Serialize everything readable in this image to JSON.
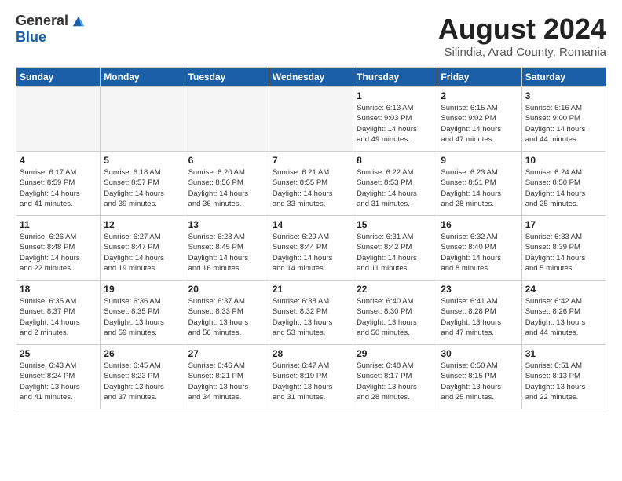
{
  "header": {
    "logo_general": "General",
    "logo_blue": "Blue",
    "main_title": "August 2024",
    "subtitle": "Silindia, Arad County, Romania"
  },
  "days_of_week": [
    "Sunday",
    "Monday",
    "Tuesday",
    "Wednesday",
    "Thursday",
    "Friday",
    "Saturday"
  ],
  "weeks": [
    [
      {
        "day": "",
        "info": ""
      },
      {
        "day": "",
        "info": ""
      },
      {
        "day": "",
        "info": ""
      },
      {
        "day": "",
        "info": ""
      },
      {
        "day": "1",
        "info": "Sunrise: 6:13 AM\nSunset: 9:03 PM\nDaylight: 14 hours\nand 49 minutes."
      },
      {
        "day": "2",
        "info": "Sunrise: 6:15 AM\nSunset: 9:02 PM\nDaylight: 14 hours\nand 47 minutes."
      },
      {
        "day": "3",
        "info": "Sunrise: 6:16 AM\nSunset: 9:00 PM\nDaylight: 14 hours\nand 44 minutes."
      }
    ],
    [
      {
        "day": "4",
        "info": "Sunrise: 6:17 AM\nSunset: 8:59 PM\nDaylight: 14 hours\nand 41 minutes."
      },
      {
        "day": "5",
        "info": "Sunrise: 6:18 AM\nSunset: 8:57 PM\nDaylight: 14 hours\nand 39 minutes."
      },
      {
        "day": "6",
        "info": "Sunrise: 6:20 AM\nSunset: 8:56 PM\nDaylight: 14 hours\nand 36 minutes."
      },
      {
        "day": "7",
        "info": "Sunrise: 6:21 AM\nSunset: 8:55 PM\nDaylight: 14 hours\nand 33 minutes."
      },
      {
        "day": "8",
        "info": "Sunrise: 6:22 AM\nSunset: 8:53 PM\nDaylight: 14 hours\nand 31 minutes."
      },
      {
        "day": "9",
        "info": "Sunrise: 6:23 AM\nSunset: 8:51 PM\nDaylight: 14 hours\nand 28 minutes."
      },
      {
        "day": "10",
        "info": "Sunrise: 6:24 AM\nSunset: 8:50 PM\nDaylight: 14 hours\nand 25 minutes."
      }
    ],
    [
      {
        "day": "11",
        "info": "Sunrise: 6:26 AM\nSunset: 8:48 PM\nDaylight: 14 hours\nand 22 minutes."
      },
      {
        "day": "12",
        "info": "Sunrise: 6:27 AM\nSunset: 8:47 PM\nDaylight: 14 hours\nand 19 minutes."
      },
      {
        "day": "13",
        "info": "Sunrise: 6:28 AM\nSunset: 8:45 PM\nDaylight: 14 hours\nand 16 minutes."
      },
      {
        "day": "14",
        "info": "Sunrise: 6:29 AM\nSunset: 8:44 PM\nDaylight: 14 hours\nand 14 minutes."
      },
      {
        "day": "15",
        "info": "Sunrise: 6:31 AM\nSunset: 8:42 PM\nDaylight: 14 hours\nand 11 minutes."
      },
      {
        "day": "16",
        "info": "Sunrise: 6:32 AM\nSunset: 8:40 PM\nDaylight: 14 hours\nand 8 minutes."
      },
      {
        "day": "17",
        "info": "Sunrise: 6:33 AM\nSunset: 8:39 PM\nDaylight: 14 hours\nand 5 minutes."
      }
    ],
    [
      {
        "day": "18",
        "info": "Sunrise: 6:35 AM\nSunset: 8:37 PM\nDaylight: 14 hours\nand 2 minutes."
      },
      {
        "day": "19",
        "info": "Sunrise: 6:36 AM\nSunset: 8:35 PM\nDaylight: 13 hours\nand 59 minutes."
      },
      {
        "day": "20",
        "info": "Sunrise: 6:37 AM\nSunset: 8:33 PM\nDaylight: 13 hours\nand 56 minutes."
      },
      {
        "day": "21",
        "info": "Sunrise: 6:38 AM\nSunset: 8:32 PM\nDaylight: 13 hours\nand 53 minutes."
      },
      {
        "day": "22",
        "info": "Sunrise: 6:40 AM\nSunset: 8:30 PM\nDaylight: 13 hours\nand 50 minutes."
      },
      {
        "day": "23",
        "info": "Sunrise: 6:41 AM\nSunset: 8:28 PM\nDaylight: 13 hours\nand 47 minutes."
      },
      {
        "day": "24",
        "info": "Sunrise: 6:42 AM\nSunset: 8:26 PM\nDaylight: 13 hours\nand 44 minutes."
      }
    ],
    [
      {
        "day": "25",
        "info": "Sunrise: 6:43 AM\nSunset: 8:24 PM\nDaylight: 13 hours\nand 41 minutes."
      },
      {
        "day": "26",
        "info": "Sunrise: 6:45 AM\nSunset: 8:23 PM\nDaylight: 13 hours\nand 37 minutes."
      },
      {
        "day": "27",
        "info": "Sunrise: 6:46 AM\nSunset: 8:21 PM\nDaylight: 13 hours\nand 34 minutes."
      },
      {
        "day": "28",
        "info": "Sunrise: 6:47 AM\nSunset: 8:19 PM\nDaylight: 13 hours\nand 31 minutes."
      },
      {
        "day": "29",
        "info": "Sunrise: 6:48 AM\nSunset: 8:17 PM\nDaylight: 13 hours\nand 28 minutes."
      },
      {
        "day": "30",
        "info": "Sunrise: 6:50 AM\nSunset: 8:15 PM\nDaylight: 13 hours\nand 25 minutes."
      },
      {
        "day": "31",
        "info": "Sunrise: 6:51 AM\nSunset: 8:13 PM\nDaylight: 13 hours\nand 22 minutes."
      }
    ]
  ]
}
